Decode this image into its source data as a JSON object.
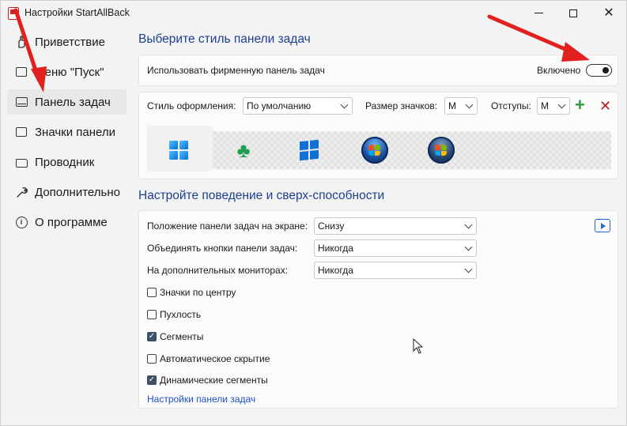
{
  "window": {
    "title": "Настройки StartAllBack",
    "controls": {
      "minimize": "minimize",
      "maximize": "maximize",
      "close": "✕"
    }
  },
  "sidebar": {
    "items": [
      {
        "label": "Приветствие",
        "icon": "welcome-icon",
        "active": false
      },
      {
        "label": "Меню \"Пуск\"",
        "icon": "start-menu-icon",
        "active": false
      },
      {
        "label": "Панель задач",
        "icon": "taskbar-icon",
        "active": true
      },
      {
        "label": "Значки панели",
        "icon": "tray-icons-icon",
        "active": false
      },
      {
        "label": "Проводник",
        "icon": "folder-icon",
        "active": false
      },
      {
        "label": "Дополнительно",
        "icon": "wrench-icon",
        "active": false
      },
      {
        "label": "О программе",
        "icon": "info-icon",
        "active": false
      }
    ]
  },
  "style_section": {
    "title": "Выберите стиль панели задач",
    "use_taskbar_label": "Использовать фирменную панель задач",
    "toggle_state_label": "Включено",
    "toggle_on": true,
    "style_label": "Стиль оформления:",
    "style_value": "По умолчанию",
    "icon_size_label": "Размер значков:",
    "icon_size_value": "M",
    "padding_label": "Отступы:",
    "padding_value": "M",
    "add_symbol": "+",
    "remove_symbol": "✕",
    "presets": [
      {
        "icon": "windows-11-logo-icon",
        "selected": true
      },
      {
        "icon": "clover-icon",
        "selected": false
      },
      {
        "icon": "windows-10-logo-icon",
        "selected": false
      },
      {
        "icon": "windows-7-orb-icon",
        "selected": false
      },
      {
        "icon": "windows-vista-orb-icon",
        "selected": false
      }
    ]
  },
  "behavior_section": {
    "title": "Настройте поведение и сверх-способности",
    "position_label": "Положение панели задач на экране:",
    "position_value": "Снизу",
    "combine_label": "Объединять кнопки панели задач:",
    "combine_value": "Никогда",
    "monitors_label": "На дополнительных мониторах:",
    "monitors_value": "Никогда",
    "checkboxes": [
      {
        "label": "Значки по центру",
        "checked": false
      },
      {
        "label": "Пухлость",
        "checked": false
      },
      {
        "label": "Сегменты",
        "checked": true
      },
      {
        "label": "Автоматическое скрытие",
        "checked": false
      },
      {
        "label": "Динамические сегменты",
        "checked": true
      }
    ],
    "link_label": "Настройки панели задач"
  },
  "colors": {
    "accent_title": "#1d3f8f",
    "link": "#1d4fc0",
    "annotation_arrow": "#e32020"
  }
}
